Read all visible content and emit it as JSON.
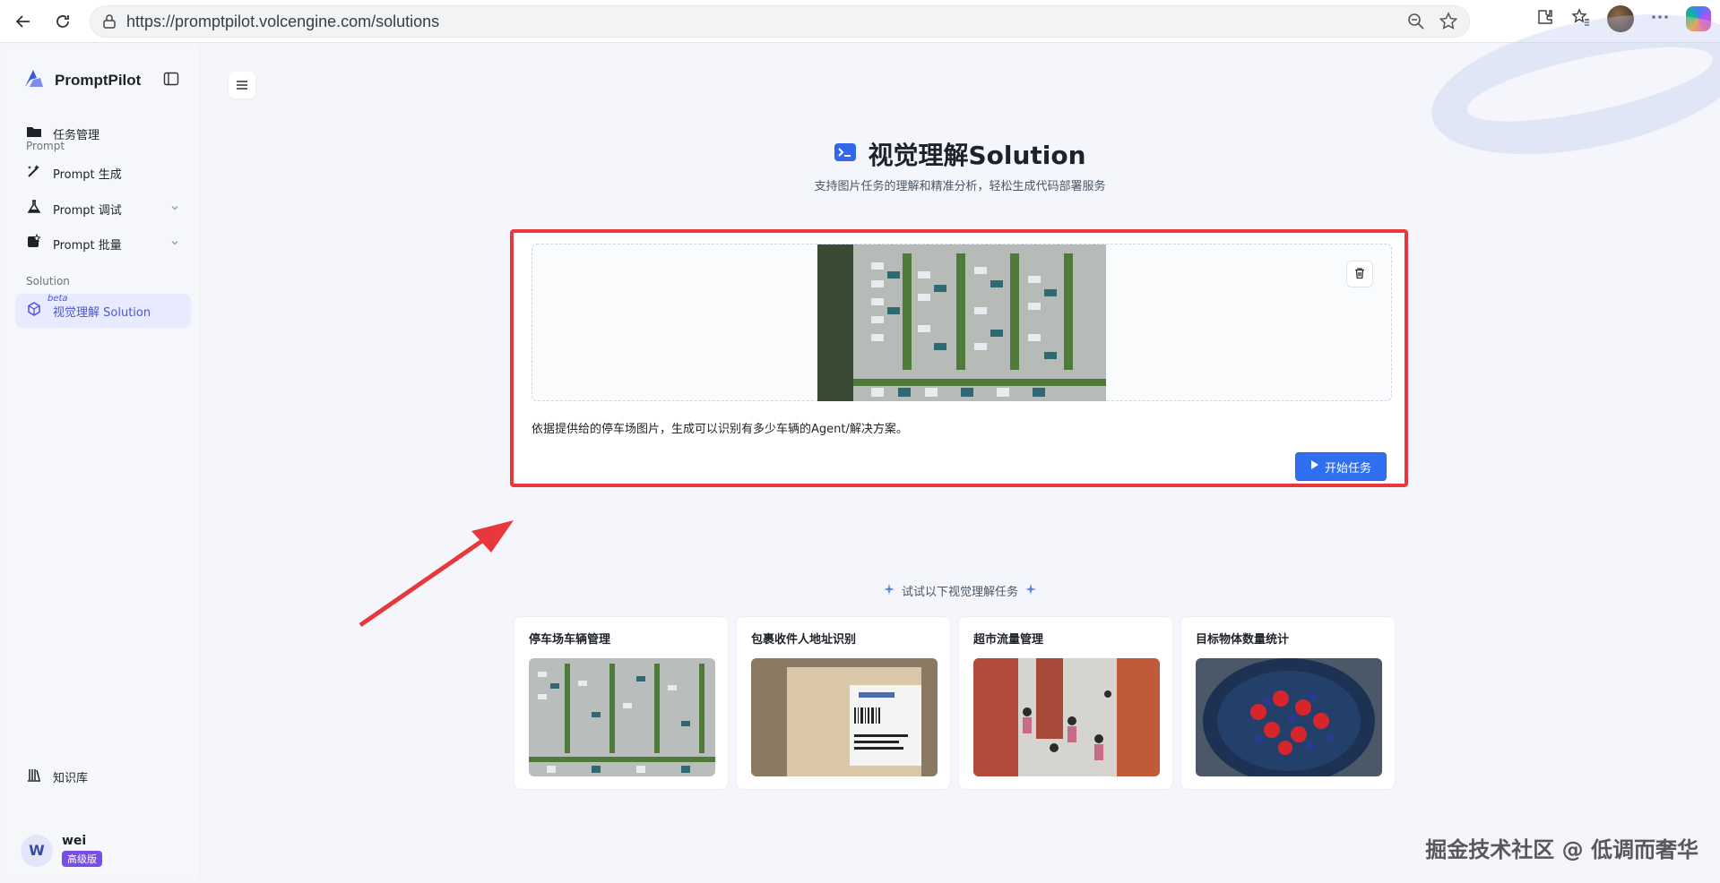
{
  "browser": {
    "url": "https://promptpilot.volcengine.com/solutions"
  },
  "sidebar": {
    "brand": "PromptPilot",
    "items": [
      {
        "label": "任务管理"
      },
      {
        "label": "Prompt 生成"
      },
      {
        "label": "Prompt 调试"
      },
      {
        "label": "Prompt 批量"
      },
      {
        "label": "视觉理解 Solution",
        "tag": "beta"
      },
      {
        "label": "知识库"
      }
    ],
    "sections": {
      "prompt": "Prompt",
      "solution": "Solution"
    },
    "user": {
      "initial": "W",
      "name": "wei",
      "plan": "高级版"
    }
  },
  "main": {
    "title": "视觉理解Solution",
    "subtitle": "支持图片任务的理解和精准分析，轻松生成代码部署服务",
    "task": {
      "prompt": "依据提供给的停车场图片，生成可以识别有多少车辆的Agent/解决方案。",
      "start_label": "开始任务"
    },
    "try_label": "试试以下视觉理解任务",
    "examples": [
      {
        "title": "停车场车辆管理"
      },
      {
        "title": "包裹收件人地址识别"
      },
      {
        "title": "超市流量管理"
      },
      {
        "title": "目标物体数量统计"
      }
    ]
  },
  "watermark": "掘金技术社区 @ 低调而奢华",
  "colors": {
    "accent": "#4a55d6",
    "primary_button": "#2f6ff0",
    "highlight_border": "#e8383d",
    "badge": "#7b4de8"
  }
}
